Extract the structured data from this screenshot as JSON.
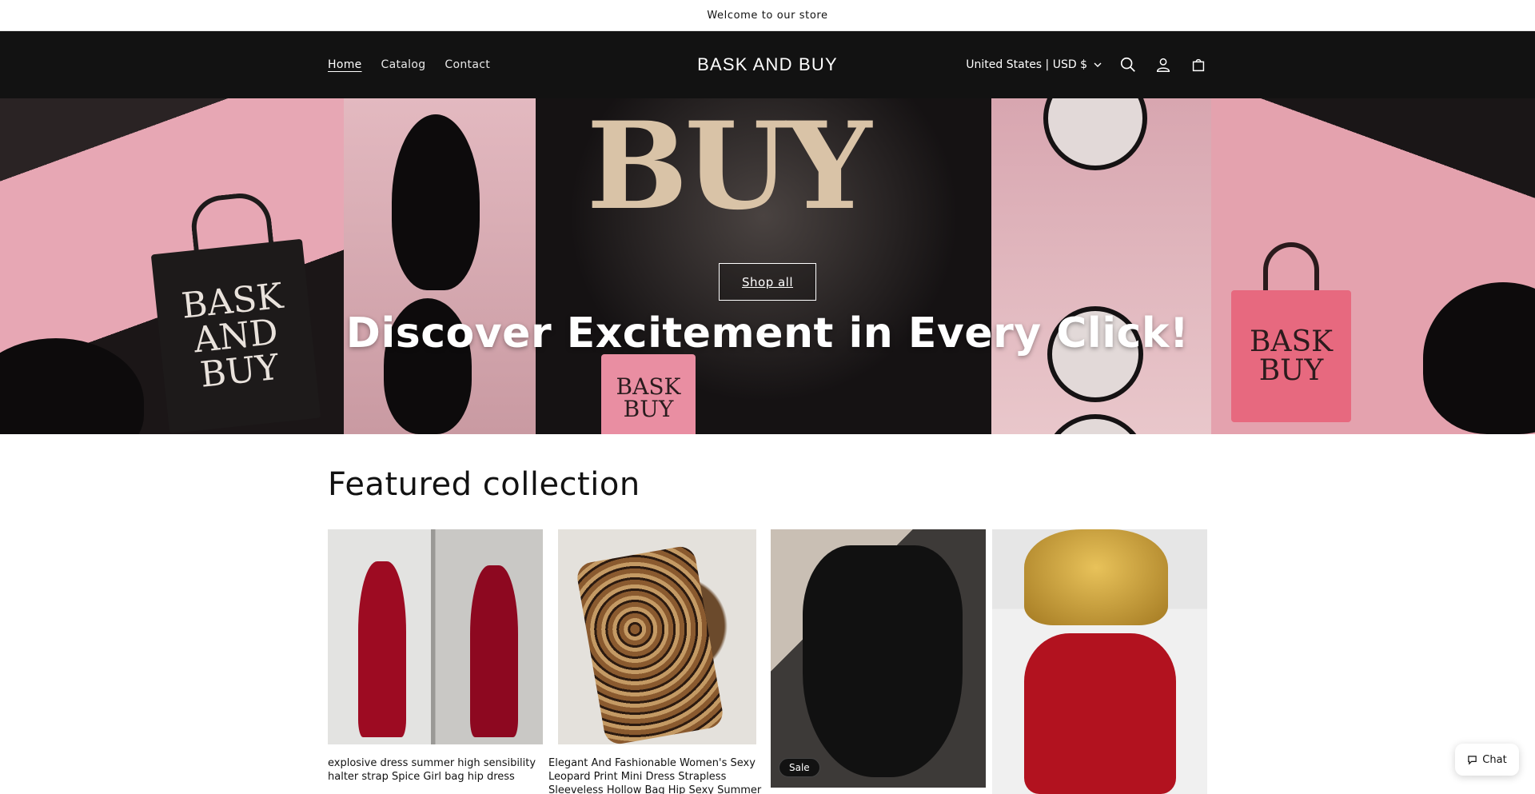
{
  "announcement": {
    "text": "Welcome to our store"
  },
  "header": {
    "nav": [
      {
        "label": "Home"
      },
      {
        "label": "Catalog"
      },
      {
        "label": "Contact"
      }
    ],
    "logo": "BASK AND BUY",
    "currency": "United States | USD $",
    "icons": [
      "search-icon",
      "account-icon",
      "cart-icon"
    ]
  },
  "hero": {
    "button": "Shop all",
    "heading": "Discover Excitement in Every Click!",
    "image_text": {
      "buy": "BUY",
      "bag1": "BASK AND BUY",
      "bag2": "BASK BUY",
      "bag3": "BASK BUY"
    }
  },
  "featured": {
    "title": "Featured collection",
    "products": [
      {
        "title": "explosive dress summer high sensibility halter strap Spice Girl bag hip dress"
      },
      {
        "title": "Elegant And Fashionable Women's Sexy Leopard Print Mini Dress Strapless Sleeveless Hollow Bag Hip Sexy Summer Holiday Dress"
      },
      {
        "title": "",
        "badge": "Sale"
      },
      {
        "title": ""
      }
    ]
  },
  "chat": {
    "label": "Chat"
  },
  "colors": {
    "header_bg": "#121212",
    "text": "#121212",
    "accent": "#ffffff"
  }
}
